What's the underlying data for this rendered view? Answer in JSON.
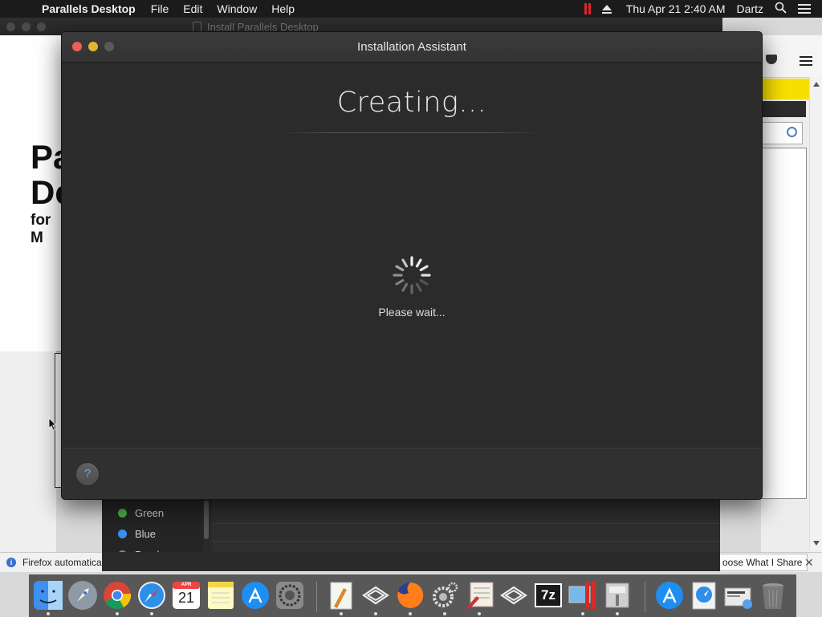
{
  "menubar": {
    "app_name": "Parallels Desktop",
    "menus": [
      "File",
      "Edit",
      "Window",
      "Help"
    ],
    "clock": "Thu Apr 21  2:40 AM",
    "user": "Dartz"
  },
  "background": {
    "browser_tab_title": "Install Parallels Desktop",
    "page_heading_line1": "Pa",
    "page_heading_line2": "De",
    "page_subheading": "for M",
    "notification_text": "Firefox automatically",
    "notification_button": "oose What I Share",
    "tags": [
      {
        "label": "Green",
        "color": "#4cb34c"
      },
      {
        "label": "Blue",
        "color": "#3d8ef0"
      },
      {
        "label": "Purple",
        "color": "#c35ad8"
      }
    ]
  },
  "installer": {
    "window_title": "Installation Assistant",
    "heading": "Creating...",
    "status": "Please wait...",
    "help_label": "?"
  },
  "dock": {
    "items": [
      "finder",
      "launchpad",
      "chrome",
      "safari",
      "calendar",
      "notes",
      "app-store",
      "system-preferences",
      "textedit",
      "parallels",
      "firefox",
      "settings-gears",
      "script-editor",
      "parallels-alt",
      "7zip",
      "parallels-desktop",
      "archive-utility",
      "app-store-2",
      "downloads",
      "documents",
      "trash"
    ],
    "calendar_month": "APR",
    "calendar_day": "21",
    "seven_zip_label": "7z"
  }
}
